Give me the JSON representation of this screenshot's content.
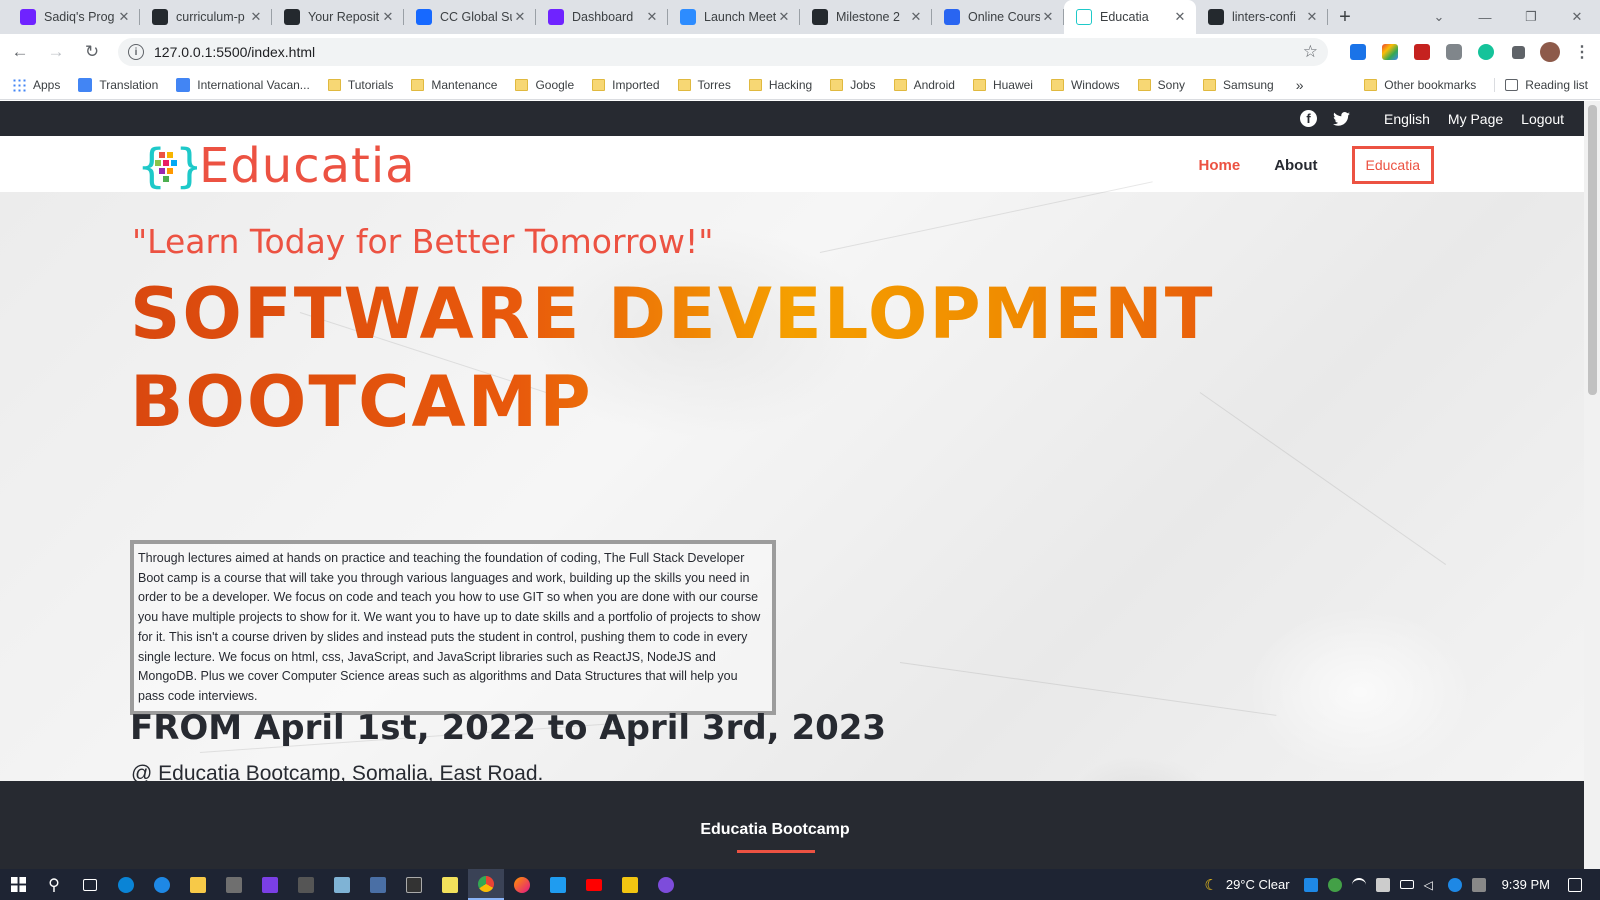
{
  "browser": {
    "tabs": [
      {
        "title": "Sadiq's Prog",
        "icon": "microverse-icon",
        "color": "#6f23ff"
      },
      {
        "title": "curriculum-p",
        "icon": "github-icon",
        "color": "#24292e"
      },
      {
        "title": "Your Reposit",
        "icon": "github-icon",
        "color": "#24292e"
      },
      {
        "title": "CC Global Su",
        "icon": "behance-icon",
        "color": "#1769ff"
      },
      {
        "title": "Dashboard",
        "icon": "microverse-icon",
        "color": "#6f23ff"
      },
      {
        "title": "Launch Meet",
        "icon": "zoom-icon",
        "color": "#2d8cff"
      },
      {
        "title": "Milestone 2",
        "icon": "github-icon",
        "color": "#24292e"
      },
      {
        "title": "Online Cours",
        "icon": "html-doc-icon",
        "color": "#2965f1"
      },
      {
        "title": "Educatia",
        "icon": "educatia-icon",
        "color": "#ffffff",
        "active": true
      },
      {
        "title": "linters-confi",
        "icon": "github-icon",
        "color": "#24292e"
      }
    ],
    "url": "127.0.0.1:5500/index.html",
    "bookmarks": [
      {
        "label": "Apps",
        "type": "apps"
      },
      {
        "label": "Translation",
        "type": "site"
      },
      {
        "label": "International Vacan...",
        "type": "site"
      },
      {
        "label": "Tutorials",
        "type": "folder"
      },
      {
        "label": "Mantenance",
        "type": "folder"
      },
      {
        "label": "Google",
        "type": "folder"
      },
      {
        "label": "Imported",
        "type": "folder"
      },
      {
        "label": "Torres",
        "type": "folder"
      },
      {
        "label": "Hacking",
        "type": "folder"
      },
      {
        "label": "Jobs",
        "type": "folder"
      },
      {
        "label": "Android",
        "type": "folder"
      },
      {
        "label": "Huawei",
        "type": "folder"
      },
      {
        "label": "Windows",
        "type": "folder"
      },
      {
        "label": "Sony",
        "type": "folder"
      },
      {
        "label": "Samsung",
        "type": "folder"
      }
    ],
    "bookmarks_overflow": "»",
    "other_bookmarks": "Other bookmarks",
    "reading_list": "Reading list"
  },
  "page": {
    "topbar": {
      "language": "English",
      "my_page": "My Page",
      "logout": "Logout"
    },
    "logo_text": "Educatia",
    "nav": {
      "home": "Home",
      "about": "About",
      "cta": "Educatia"
    },
    "hero": {
      "tagline": "\"Learn Today for Better Tomorrow!\"",
      "headline_line1": "SOFTWARE DEVELOPMENT",
      "headline_line2": "BOOTCAMP",
      "description": "Through lectures aimed at hands on practice and teaching the foundation of coding, The Full Stack Developer Boot camp is a course that will take you through various languages and work, building up the skills you need in order to be a developer. We focus on code and teach you how to use GIT so when you are done with our course you have multiple projects to show for it. We want you to have up to date skills and a portfolio of projects to show for it. This isn't a course driven by slides and instead puts the student in control, pushing them to code in every single lecture. We focus on html, css, JavaScript, and JavaScript libraries such as ReactJS, NodeJS and MongoDB. Plus we cover Computer Science areas such as algorithms and Data Structures that will help you pass code interviews.",
      "dates": "FROM April 1st, 2022 to April 3rd, 2023",
      "venue": "@ Educatia Bootcamp, Somalia, East Road."
    },
    "footer_title": "Educatia Bootcamp",
    "accent_color": "#ec5242",
    "dark_color": "#272a31"
  },
  "taskbar": {
    "weather": "29°C  Clear",
    "time": "9:39 PM"
  }
}
